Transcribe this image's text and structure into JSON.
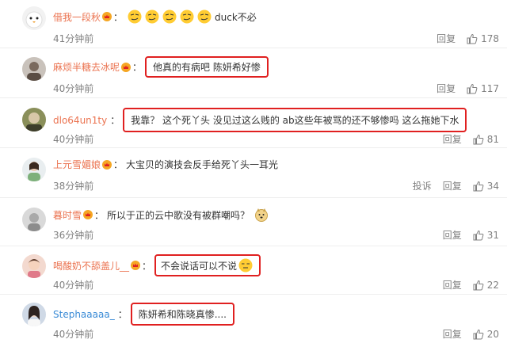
{
  "colors": {
    "username": "#eb7350",
    "meta": "#808080",
    "highlight": "#e02020"
  },
  "comments": [
    {
      "user": "借我一段秋",
      "text": "duck不必",
      "emoji_count": 5,
      "time": "41分钟前",
      "reply": "回复",
      "likes": "178",
      "avatar": "bird-avatar"
    },
    {
      "user": "麻烦半糖去冰呢",
      "text": "他真的有病吧 陈妍希好惨",
      "time": "40分钟前",
      "reply": "回复",
      "likes": "117",
      "avatar": "person-avatar"
    },
    {
      "user": "dlo64un1ty",
      "text": "我靠？ 这个死丫头 没见过这么贱的 ab这些年被骂的还不够惨吗 这么拖她下水",
      "time": "40分钟前",
      "reply": "回复",
      "likes": "81",
      "avatar": "person-avatar"
    },
    {
      "user": "上元雪媚娘",
      "text": "大宝贝的演技会反手给死丫头一耳光",
      "time": "38分钟前",
      "report": "投诉",
      "reply": "回复",
      "likes": "34",
      "avatar": "person-avatar"
    },
    {
      "user": "暮时雪",
      "text": "所以于正的云中歌没有被群嘲吗？",
      "time": "36分钟前",
      "reply": "回复",
      "likes": "31",
      "avatar": "person-avatar"
    },
    {
      "user": "喝酸奶不舔盖儿__",
      "text": "不会说话可以不说",
      "time": "40分钟前",
      "reply": "回复",
      "likes": "22",
      "avatar": "person-avatar"
    },
    {
      "user": "Stephaaaaa_",
      "text": "陈妍希和陈晓真惨....",
      "time": "40分钟前",
      "reply": "回复",
      "likes": "20",
      "avatar": "person-avatar"
    }
  ]
}
